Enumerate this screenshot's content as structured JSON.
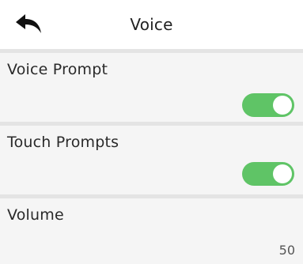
{
  "header": {
    "title": "Voice",
    "back_icon": "back-arrow-icon"
  },
  "settings": [
    {
      "label": "Voice Prompt",
      "type": "toggle",
      "enabled": true
    },
    {
      "label": "Touch Prompts",
      "type": "toggle",
      "enabled": true
    },
    {
      "label": "Volume",
      "type": "value",
      "value": "50"
    }
  ],
  "colors": {
    "toggle_on": "#5fc466",
    "row_background": "#f5f5f5",
    "divider": "#e4e4e4"
  }
}
